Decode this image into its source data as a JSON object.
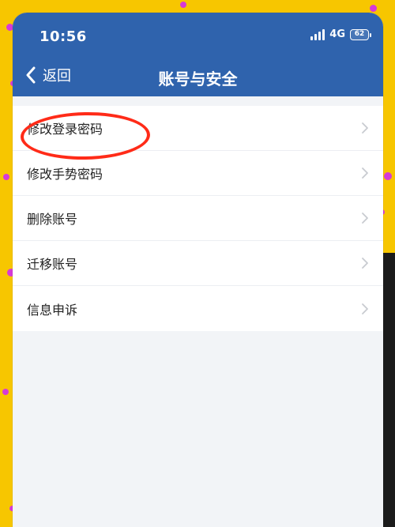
{
  "status_bar": {
    "time": "10:56",
    "network": "4G",
    "battery": "62"
  },
  "header": {
    "back_label": "返回",
    "title": "账号与安全"
  },
  "menu": {
    "items": [
      {
        "label": "修改登录密码"
      },
      {
        "label": "修改手势密码"
      },
      {
        "label": "删除账号"
      },
      {
        "label": "迁移账号"
      },
      {
        "label": "信息申诉"
      }
    ]
  },
  "colors": {
    "header_bg": "#2f63ad",
    "highlight_ring": "#ff2b18",
    "page_bg": "#f2f4f7"
  }
}
